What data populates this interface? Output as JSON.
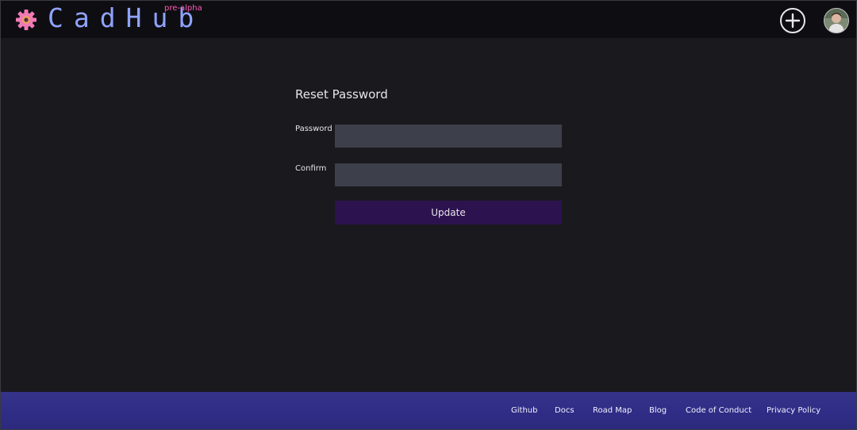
{
  "header": {
    "logo_text": "CadHub",
    "badge": "pre-alpha",
    "add_icon": "plus-circle-icon",
    "logo_icon": "gear-icon",
    "brand_color": "#8fa3ff",
    "badge_color": "#ff5ab8"
  },
  "form": {
    "title": "Reset Password",
    "password_label": "Password",
    "password_value": "",
    "confirm_label": "Confirm",
    "confirm_value": "",
    "submit_label": "Update",
    "submit_color": "#2d1250"
  },
  "footer": {
    "links": [
      {
        "label": "Github"
      },
      {
        "label": "Docs"
      },
      {
        "label": "Road Map"
      },
      {
        "label": "Blog"
      },
      {
        "label": "Code of Conduct"
      },
      {
        "label": "Privacy Policy"
      }
    ],
    "background": "#2f2c85"
  }
}
